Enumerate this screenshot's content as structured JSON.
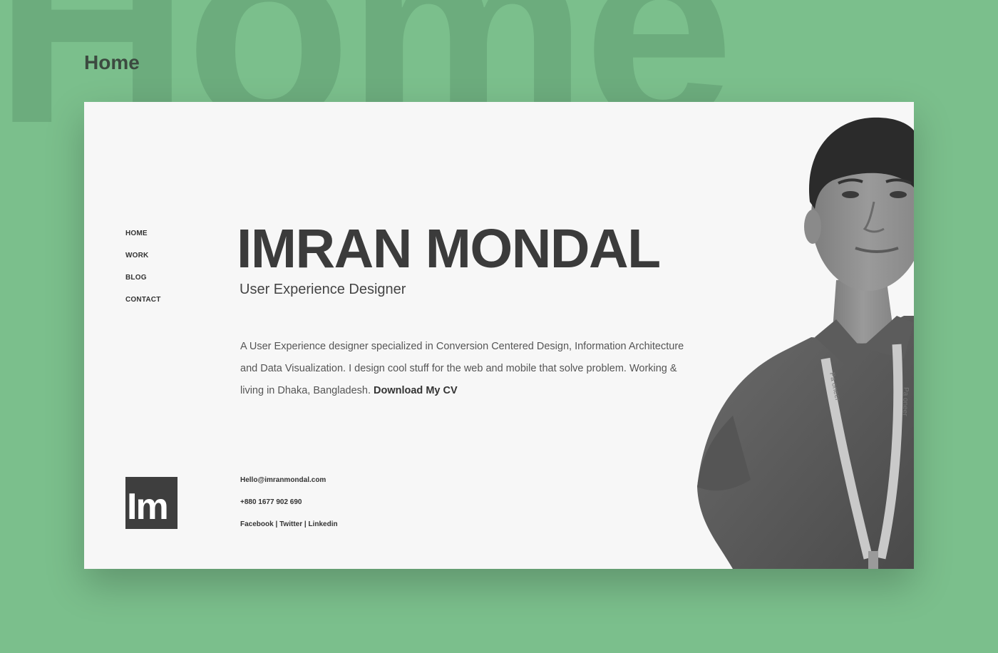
{
  "background": {
    "word": "Home",
    "color": "#7bbf8c"
  },
  "page_label": "Home",
  "nav": {
    "items": [
      {
        "label": "HOME"
      },
      {
        "label": "WORK"
      },
      {
        "label": "BLOG"
      },
      {
        "label": "CONTACT"
      }
    ]
  },
  "hero": {
    "name": "IMRAN MONDAL",
    "role": "User Experience Designer",
    "bio": "A User Experience designer specialized in Conversion Centered Design, Information Architecture and Data Visualization. I design cool stuff for the web and mobile that solve problem. Working & living in Dhaka, Bangladesh.",
    "cv_link": "Download My CV"
  },
  "logo": {
    "text": "Im"
  },
  "contact": {
    "email": "Hello@imranmondal.com",
    "phone": "+880 1677 902 690",
    "social": [
      {
        "label": "Facebook"
      },
      {
        "label": "Twitter"
      },
      {
        "label": "Linkedin"
      }
    ],
    "separator": "|"
  },
  "photo": {
    "icon": "portrait-photo",
    "lanyard_text": "Pa oneer"
  },
  "colors": {
    "accent_bg": "#7bbf8c",
    "card_bg": "#f7f7f7",
    "text_dark": "#3b3b3b",
    "logo_bg": "#3e3e3e"
  }
}
